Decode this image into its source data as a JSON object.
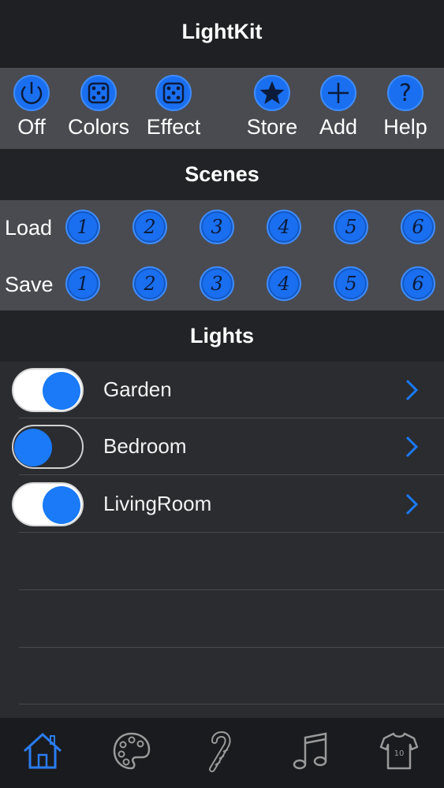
{
  "app": {
    "title": "LightKit"
  },
  "toolbar": {
    "items": [
      {
        "label": "Off",
        "icon": "power-icon"
      },
      {
        "label": "Colors",
        "icon": "dice-icon"
      },
      {
        "label": "Effect",
        "icon": "dice-icon"
      },
      {
        "label": "Store",
        "icon": "star-icon"
      },
      {
        "label": "Add",
        "icon": "plus-icon"
      },
      {
        "label": "Help",
        "icon": "question-icon"
      }
    ]
  },
  "scenes": {
    "header": "Scenes",
    "load_label": "Load",
    "save_label": "Save",
    "slots": [
      "1",
      "2",
      "3",
      "4",
      "5",
      "6"
    ]
  },
  "lights": {
    "header": "Lights",
    "items": [
      {
        "name": "Garden",
        "on": true
      },
      {
        "name": "Bedroom",
        "on": false
      },
      {
        "name": "LivingRoom",
        "on": true
      }
    ]
  },
  "tabs": [
    {
      "icon": "home-icon",
      "active": true
    },
    {
      "icon": "palette-icon",
      "active": false
    },
    {
      "icon": "candy-cane-icon",
      "active": false
    },
    {
      "icon": "music-note-icon",
      "active": false
    },
    {
      "icon": "jersey-icon",
      "active": false
    }
  ],
  "colors": {
    "accent": "#1a7af8",
    "active_tab": "#2a7cf2",
    "inactive_tab": "#9a9a9a"
  }
}
